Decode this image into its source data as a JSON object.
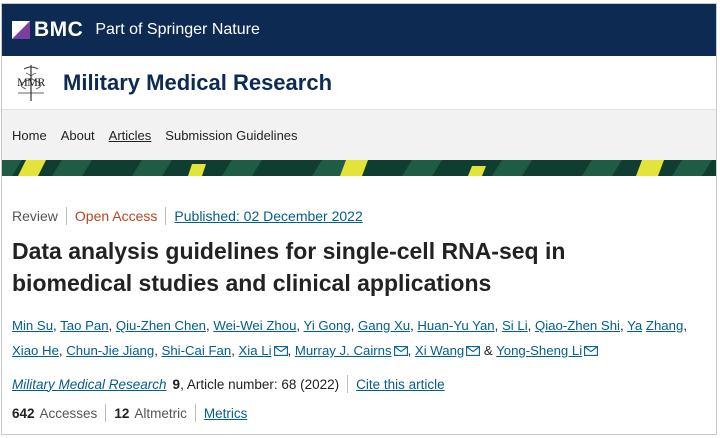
{
  "brand": {
    "logo_text": "BMC",
    "tagline": "Part of Springer Nature"
  },
  "journal": {
    "logo_text": "MMR",
    "title": "Military Medical Research"
  },
  "nav": {
    "items": [
      {
        "label": "Home",
        "active": false
      },
      {
        "label": "About",
        "active": false
      },
      {
        "label": "Articles",
        "active": true
      },
      {
        "label": "Submission Guidelines",
        "active": false
      }
    ]
  },
  "article": {
    "type": "Review",
    "access": "Open Access",
    "published": "Published: 02 December 2022",
    "title_line1": "Data analysis guidelines for single-cell RNA-seq in",
    "title_line2": "biomedical studies and clinical applications",
    "authors": [
      {
        "name": "Min Su",
        "email": false
      },
      {
        "name": "Tao Pan",
        "email": false
      },
      {
        "name": "Qiu-Zhen Chen",
        "email": false
      },
      {
        "name": "Wei-Wei Zhou",
        "email": false
      },
      {
        "name": "Yi Gong",
        "email": false
      },
      {
        "name": "Gang Xu",
        "email": false
      },
      {
        "name": "Huan-Yu Yan",
        "email": false
      },
      {
        "name": "Si Li",
        "email": false
      },
      {
        "name": "Qiao-Zhen Shi",
        "email": false
      },
      {
        "name": "Ya",
        "email": false
      },
      {
        "name": "Zhang",
        "email": false
      },
      {
        "name": "Xiao He",
        "email": false
      },
      {
        "name": "Chun-Jie Jiang",
        "email": false
      },
      {
        "name": "Shi-Cai Fan",
        "email": false
      },
      {
        "name": "Xia Li",
        "email": true
      },
      {
        "name": "Murray J. Cairns",
        "email": true
      },
      {
        "name": "Xi Wang",
        "email": true
      },
      {
        "name": "Yong-Sheng Li",
        "email": true
      }
    ],
    "journal_name": "Military Medical Research",
    "volume": "9",
    "article_number": ", Article number: 68 (2022)",
    "cite_label": "Cite this article",
    "accesses_count": "642",
    "accesses_label": "Accesses",
    "altmetric_count": "12",
    "altmetric_label": "Altmetric",
    "metrics_label": "Metrics"
  },
  "colors": {
    "brand_navy": "#0c2a52",
    "link_blue": "#025e8d",
    "open_access_orange": "#b6461d",
    "band_green": "#0f3d2f",
    "band_yellow": "#e3e33a"
  }
}
